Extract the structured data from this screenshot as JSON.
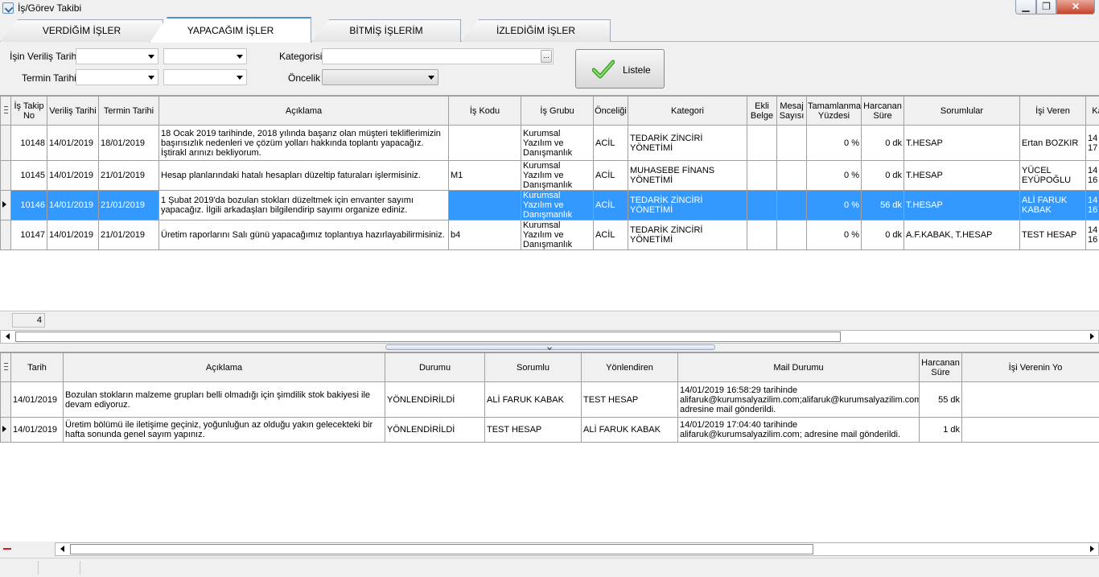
{
  "window": {
    "title": "İş/Görev Takibi",
    "min_symbol": "▁",
    "max_symbol": "❐",
    "close_symbol": "✕"
  },
  "tabs": [
    {
      "label": "VERDİĞİM İŞLER",
      "active": false
    },
    {
      "label": "YAPACAĞIM İŞLER",
      "active": true
    },
    {
      "label": "BİTMİŞ İŞLERİM",
      "active": false
    },
    {
      "label": "İZLEDİĞİM İŞLER",
      "active": false
    }
  ],
  "filters": {
    "verilis_label": "İşin Veriliş Tarihi",
    "termin_label": "Termin Tarihi",
    "kategori_label": "Kategorisi",
    "oncelik_label": "Öncelik",
    "dots": "...",
    "listele_label": "Listele"
  },
  "grid1": {
    "headers": [
      "İş Takip No",
      "Veriliş Tarihi",
      "Termin Tarihi",
      "Açıklama",
      "İş Kodu",
      "İş Grubu",
      "Önceliği",
      "Kategori",
      "Ekli Belge",
      "Mesaj Sayısı",
      "Tamamlanma Yüzdesi",
      "Harcanan Süre",
      "Sorumlular",
      "İşi Veren",
      "Ka"
    ],
    "rows": [
      {
        "no": "10148",
        "verilis": "14/01/2019",
        "termin": "18/01/2019",
        "aciklama": "18 Ocak 2019 tarihinde, 2018 yılında başarız olan müşteri tekliflerimizin başırısızlık nedenleri ve çözüm yolları hakkında toplantı yapacağız. İştirakl arınızı bekliyorum.",
        "kod": "",
        "grup": "Kurumsal Yazılım ve Danışmanlık",
        "oncelik": "ACİL",
        "kategori": "TEDARİK ZİNCİRİ YÖNETİMİ",
        "belge": "",
        "mesaj": "",
        "yuzde": "0 %",
        "sure": "0 dk",
        "sorumlu": "T.HESAP",
        "veren": "Ertan BOZKIR",
        "ka": "14 17"
      },
      {
        "no": "10145",
        "verilis": "14/01/2019",
        "termin": "21/01/2019",
        "aciklama": "Hesap planlarındaki hatalı hesapları düzeltip faturaları işlermisiniz.",
        "kod": "M1",
        "grup": "Kurumsal Yazılım ve Danışmanlık",
        "oncelik": "ACİL",
        "kategori": "MUHASEBE FİNANS YÖNETİMİ",
        "belge": "",
        "mesaj": "",
        "yuzde": "0 %",
        "sure": "0 dk",
        "sorumlu": "T.HESAP",
        "veren": "YÜCEL EYÜPOĞLU",
        "ka": "14 16"
      },
      {
        "no": "10146",
        "verilis": "14/01/2019",
        "termin": "21/01/2019",
        "aciklama": "1 Şubat 2019'da bozulan stokları düzeltmek için envanter sayımı yapacağız. İlgili arkadaşları bilgilendirip sayımı organize ediniz.",
        "kod": "",
        "grup": "Kurumsal Yazılım ve Danışmanlık",
        "oncelik": "ACİL",
        "kategori": "TEDARİK ZİNCİRİ YÖNETİMİ",
        "belge": "",
        "mesaj": "",
        "yuzde": "0 %",
        "sure": "56 dk",
        "sorumlu": "T.HESAP",
        "veren": "ALİ FARUK KABAK",
        "ka": "14 16",
        "selected": true
      },
      {
        "no": "10147",
        "verilis": "14/01/2019",
        "termin": "21/01/2019",
        "aciklama": "Üretim raporlarını Salı günü yapacağımız toplantıya hazırlayabilirmisiniz.",
        "kod": "b4",
        "grup": "Kurumsal Yazılım ve Danışmanlık",
        "oncelik": "ACİL",
        "kategori": "TEDARİK ZİNCİRİ YÖNETİMİ",
        "belge": "",
        "mesaj": "",
        "yuzde": "0 %",
        "sure": "0 dk",
        "sorumlu": "A.F.KABAK, T.HESAP",
        "veren": "TEST HESAP",
        "ka": "14 16"
      }
    ],
    "count": "4"
  },
  "grid2": {
    "headers": [
      "Tarih",
      "Açıklama",
      "Durumu",
      "Sorumlu",
      "Yönlendiren",
      "Mail Durumu",
      "Harcanan Süre",
      "İşi Verenin Yo"
    ],
    "rows": [
      {
        "tarih": "14/01/2019",
        "aciklama": "Bozulan stokların malzeme grupları belli olmadığı için şimdilik stok bakiyesi ile devam ediyoruz.",
        "durum": "YÖNLENDİRİLDİ",
        "sorumlu": "ALİ FARUK KABAK",
        "yonlendiren": "TEST HESAP",
        "mail": "14/01/2019 16:58:29 tarihinde alifaruk@kurumsalyazilim.com;alifaruk@kurumsalyazilim.com adresine mail gönderildi.",
        "sure": "55 dk",
        "yorum": ""
      },
      {
        "tarih": "14/01/2019",
        "aciklama": "Üretim bölümü ile iletişime geçiniz, yoğunluğun az olduğu yakın gelecekteki bir hafta sonunda genel sayım yapınız.",
        "durum": "YÖNLENDİRİLDİ",
        "sorumlu": "TEST HESAP",
        "yonlendiren": "ALİ FARUK KABAK",
        "mail": "14/01/2019 17:04:40 tarihinde alifaruk@kurumsalyazilim.com; adresine mail gönderildi.",
        "sure": "1 dk",
        "yorum": "",
        "current": true
      }
    ]
  }
}
